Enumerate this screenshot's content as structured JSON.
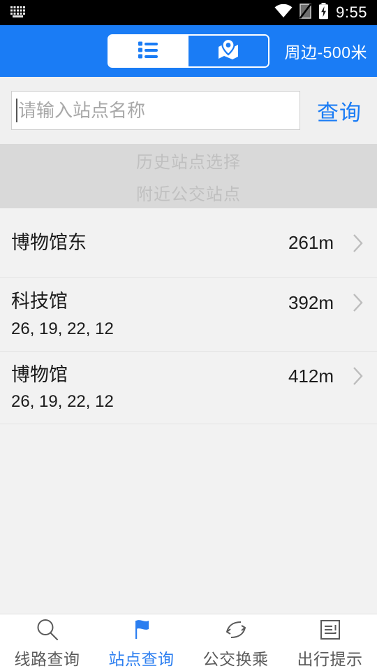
{
  "statusbar": {
    "keyboard_icon": "keyboard-icon",
    "wifi_icon": "wifi-icon",
    "sim_icon": "sim-card-icon",
    "battery_icon": "battery-charging-icon",
    "time": "9:55"
  },
  "header": {
    "segment_list_icon": "list-view-icon",
    "segment_map_icon": "map-pin-icon",
    "radius_label": "周边-500米",
    "background_color": "#1a7cf5"
  },
  "search": {
    "placeholder": "请输入站点名称",
    "value": "",
    "query_label": "查询",
    "accent_color": "#1a7cf5"
  },
  "sections": {
    "history_label": "历史站点选择",
    "nearby_label": "附近公交站点"
  },
  "stations": [
    {
      "name": "博物馆东",
      "routes": "",
      "distance": "261m",
      "chevron": "chevron-right-icon"
    },
    {
      "name": "科技馆",
      "routes": "26, 19, 22, 12",
      "distance": "392m",
      "chevron": "chevron-right-icon"
    },
    {
      "name": "博物馆",
      "routes": "26, 19, 22, 12",
      "distance": "412m",
      "chevron": "chevron-right-icon"
    }
  ],
  "tabbar": {
    "active_color": "#2b7ef0",
    "inactive_color": "#5a5a5a",
    "items": [
      {
        "label": "线路查询",
        "icon": "search-icon",
        "active": false
      },
      {
        "label": "站点查询",
        "icon": "flag-icon",
        "active": true
      },
      {
        "label": "公交换乘",
        "icon": "transfer-arrows-icon",
        "active": false
      },
      {
        "label": "出行提示",
        "icon": "notice-document-icon",
        "active": false
      }
    ]
  }
}
